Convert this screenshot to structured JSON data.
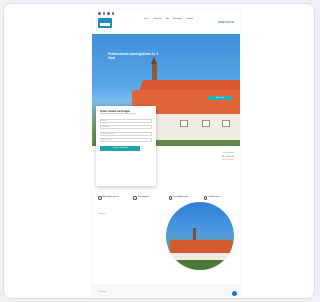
{
  "header": {
    "nav": [
      "Home",
      "Over ons",
      "Wat",
      "Werkwijze",
      "Contact"
    ],
    "nav_active_index": 0,
    "brand_right": "VERHUUR"
  },
  "hero": {
    "title": "Professionele woningbeheer in ’t Gooi",
    "cta": "Meer info"
  },
  "form": {
    "title": "Gratis taxatie aanvragen",
    "subtitle": "Vul het formulier in en wij nemen contact met u op",
    "fields": [
      "Naam",
      "E-mailadres",
      "Telefoonnummer",
      "Adres woning"
    ],
    "submit": "Verstuur aanvraag"
  },
  "contact": {
    "line1": "Bel ons direct",
    "line2": "035 - 000 00 00",
    "line3": "info@verhuur.nl"
  },
  "features": [
    {
      "text": "Betrouwbare partner",
      "icon": "check-icon"
    },
    {
      "text": "Snel geregeld",
      "icon": "clock-icon"
    },
    {
      "text": "Persoonlijk contact",
      "icon": "user-icon"
    },
    {
      "text": "Lokale kennis",
      "icon": "home-icon"
    }
  ],
  "section_label": "Over ons",
  "footer_text": "© Verhuur",
  "colors": {
    "accent": "#1fa3a8",
    "brand": "#1e88b9",
    "roof": "#d9572c"
  }
}
